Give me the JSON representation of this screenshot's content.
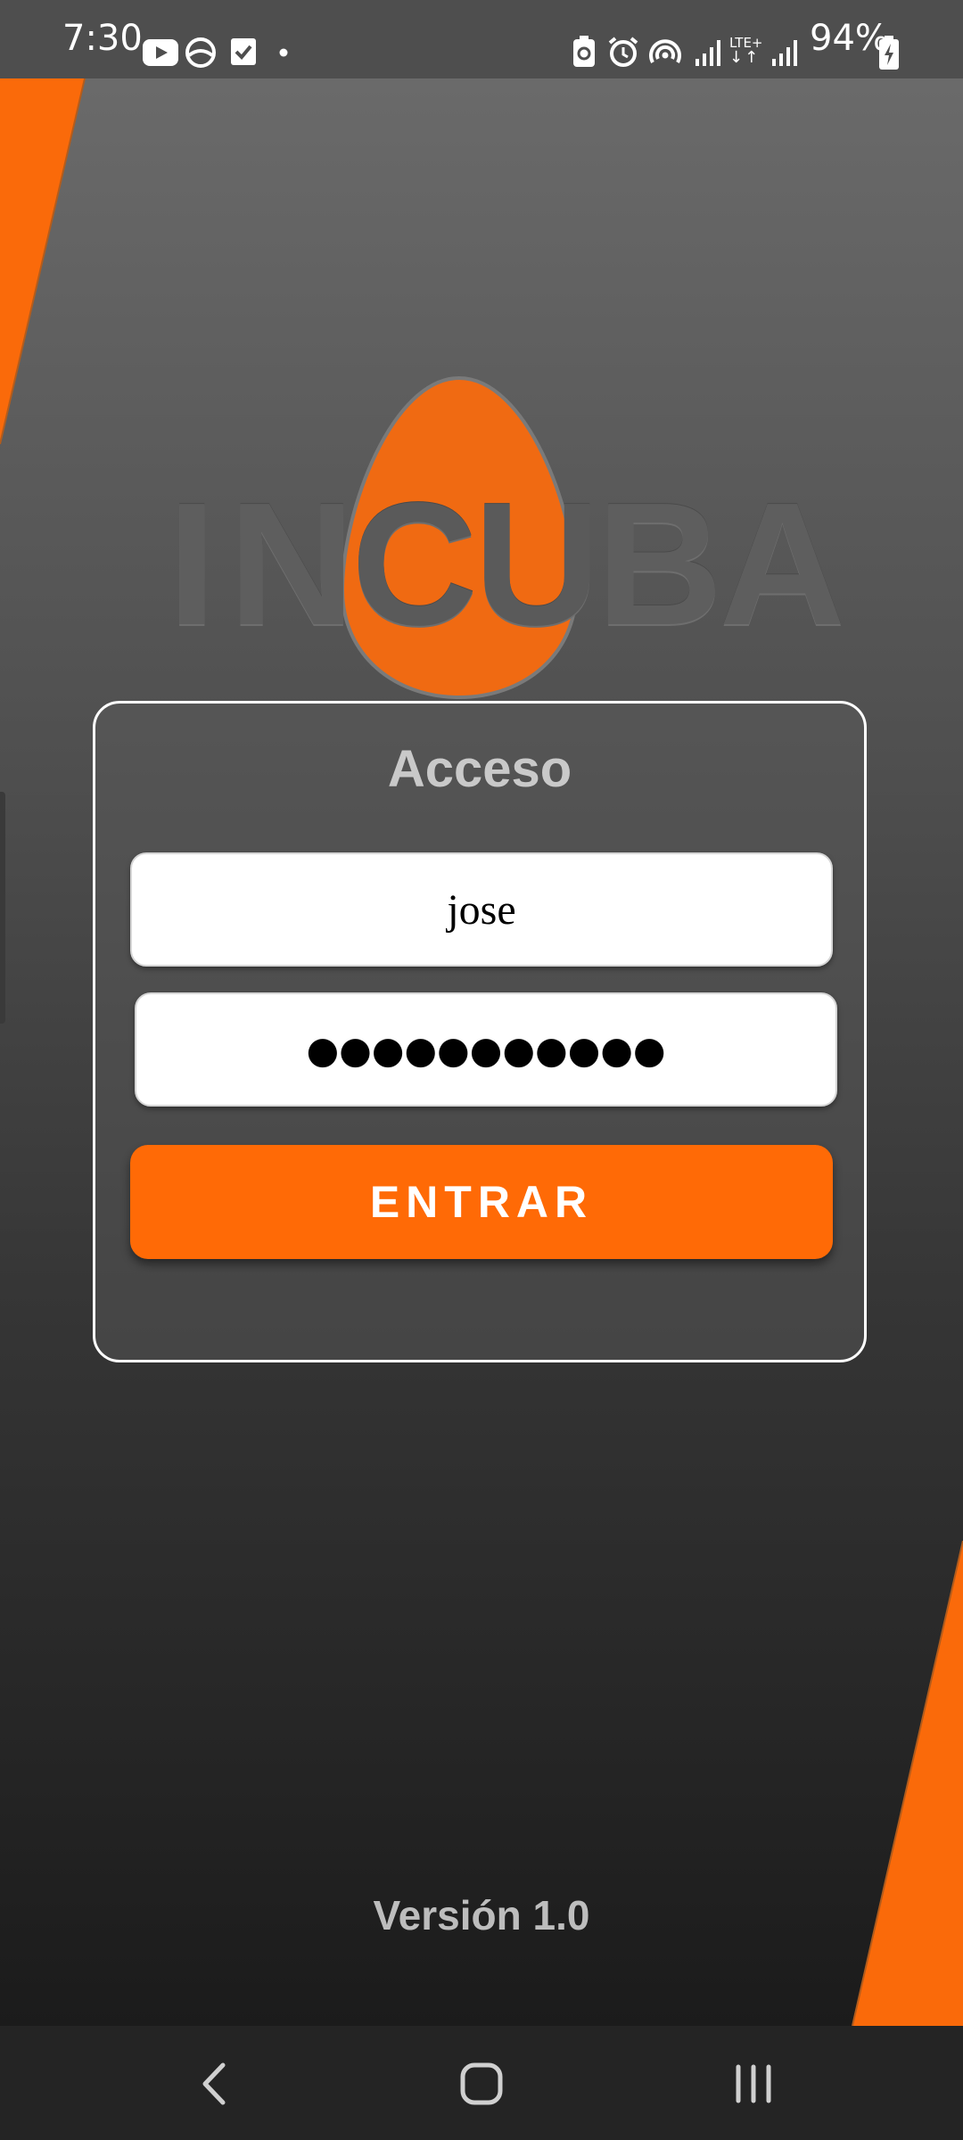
{
  "status_bar": {
    "time": "7:30",
    "battery_percent": "94%",
    "left_icons": [
      "youtube-icon",
      "browser-icon",
      "checkbox-icon",
      "dot-icon"
    ],
    "right_icons": [
      "battery-saver-icon",
      "alarm-icon",
      "hotspot-icon",
      "signal-icon",
      "lte-icon",
      "signal-icon",
      "battery-charging-icon"
    ],
    "lte_label": "LTE+"
  },
  "logo": {
    "letters": [
      "I",
      "N",
      "C",
      "U",
      "B",
      "A"
    ],
    "egg_color": "#ff6a06"
  },
  "login": {
    "title": "Acceso",
    "username_value": "jose",
    "password_mask": "●●●●●●●●●●●",
    "submit_label": "ENTRAR"
  },
  "footer": {
    "version": "Versión 1.0"
  },
  "nav": {
    "icons": [
      "back-icon",
      "home-icon",
      "recents-icon"
    ]
  },
  "colors": {
    "accent": "#ff6a06",
    "status_bar": "#4e4e4e",
    "nav_bar": "#242424"
  }
}
